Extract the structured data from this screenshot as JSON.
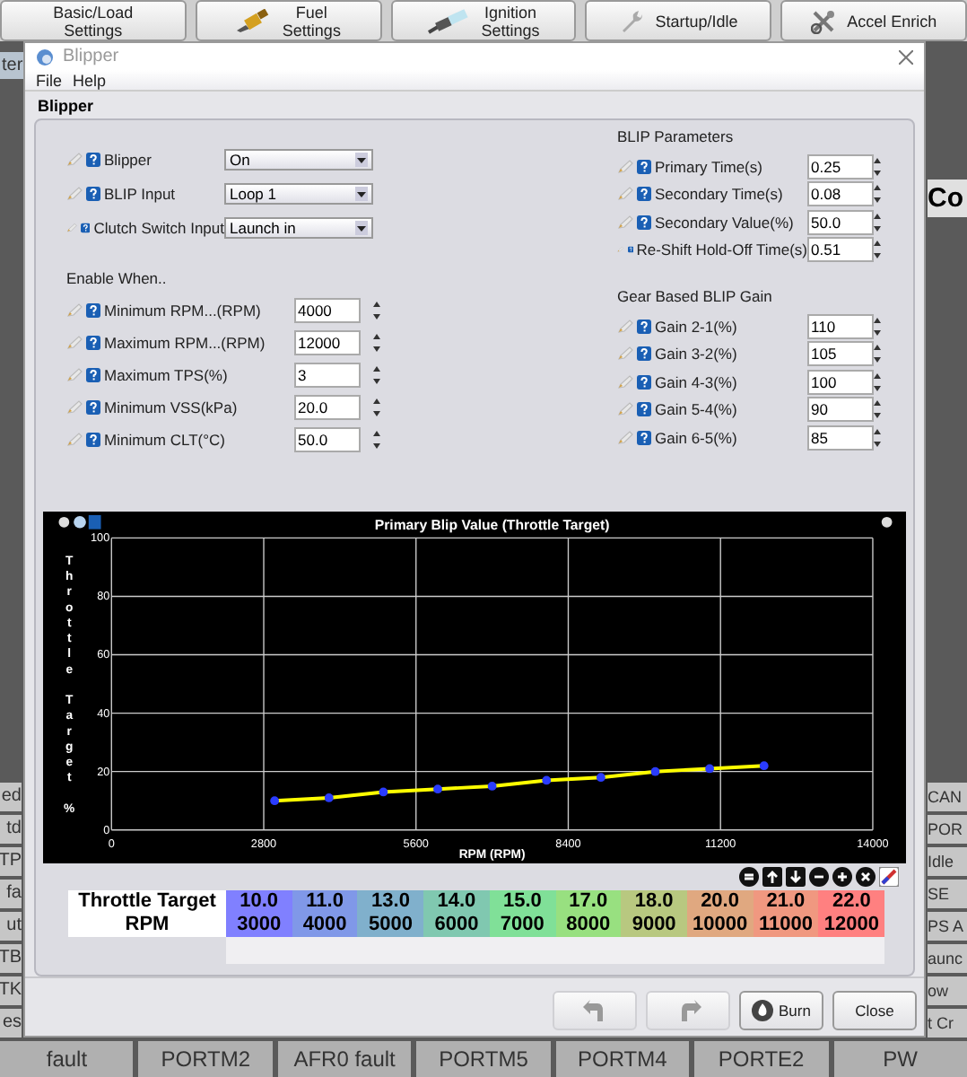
{
  "app": {
    "toolbar": [
      {
        "kind": "plain",
        "lines": [
          "Basic/Load",
          "Settings"
        ]
      },
      {
        "kind": "injector",
        "lines": [
          "Fuel",
          "Settings"
        ]
      },
      {
        "kind": "sparkplug",
        "lines": [
          "Ignition",
          "Settings"
        ]
      },
      {
        "kind": "wrench",
        "lines": [
          "Startup/Idle"
        ]
      },
      {
        "kind": "tools",
        "lines": [
          "Accel Enrich"
        ]
      }
    ],
    "side_tab": "ter",
    "right_heading": "Co",
    "left_strip": [
      "ed",
      "td",
      "TP",
      "fa",
      "ut",
      "TB",
      "TK",
      "es"
    ],
    "right_strip": [
      "CAN",
      "POR",
      "Idle",
      "SE",
      "PS A",
      "aunc",
      "ow",
      "t Cr"
    ],
    "bottom_row": [
      "fault",
      "PORTM2",
      "AFR0 fault",
      "PORTM5",
      "PORTM4",
      "PORTE2",
      "PW"
    ]
  },
  "window": {
    "title": "Blipper",
    "menu": [
      "File",
      "Help"
    ],
    "panel_title": "Blipper",
    "selects": [
      {
        "label": "Blipper",
        "value": "On"
      },
      {
        "label": "BLIP Input",
        "value": "Loop 1"
      },
      {
        "label": "Clutch Switch Input",
        "value": "Launch in"
      }
    ],
    "enable_when": {
      "title": "Enable When..",
      "fields": [
        {
          "label": "Minimum RPM...(RPM)",
          "value": "4000"
        },
        {
          "label": "Maximum RPM...(RPM)",
          "value": "12000"
        },
        {
          "label": "Maximum TPS(%)",
          "value": "3"
        },
        {
          "label": "Minimum VSS(kPa)",
          "value": "20.0"
        },
        {
          "label": "Minimum CLT(°C)",
          "value": "50.0"
        }
      ]
    },
    "blip_parameters": {
      "title": "BLIP Parameters",
      "fields": [
        {
          "label": "Primary Time(s)",
          "value": "0.25"
        },
        {
          "label": "Secondary Time(s)",
          "value": "0.08"
        },
        {
          "label": "Secondary Value(%)",
          "value": "50.0"
        },
        {
          "label": "Re-Shift Hold-Off Time(s)",
          "value": "0.51"
        }
      ]
    },
    "gear_gain": {
      "title": "Gear Based BLIP Gain",
      "fields": [
        {
          "label": "Gain 2-1(%)",
          "value": "110"
        },
        {
          "label": "Gain 3-2(%)",
          "value": "105"
        },
        {
          "label": "Gain 4-3(%)",
          "value": "100"
        },
        {
          "label": "Gain 5-4(%)",
          "value": "90"
        },
        {
          "label": "Gain 6-5(%)",
          "value": "85"
        }
      ]
    },
    "chart_data": {
      "type": "line",
      "title": "Primary Blip Value (Throttle Target)",
      "xlabel": "RPM (RPM)",
      "ylabel": "Throttle Target %",
      "x": [
        3000,
        4000,
        5000,
        6000,
        7000,
        8000,
        9000,
        10000,
        11000,
        12000
      ],
      "series": [
        {
          "color": "#ffff00",
          "marker": "circle",
          "values": [
            10,
            11,
            13,
            14,
            15,
            17,
            18,
            20,
            21,
            22
          ]
        }
      ],
      "grid": true,
      "xlim": [
        0,
        14000
      ],
      "ylim": [
        0,
        100
      ],
      "xticks": [
        0,
        2800,
        5600,
        8400,
        11200,
        14000
      ],
      "yticks": [
        0,
        20,
        40,
        60,
        80,
        100
      ]
    },
    "table": {
      "row_headers": [
        "Throttle Target",
        "RPM"
      ],
      "columns": [
        {
          "value": "10.0",
          "rpm": "3000",
          "color": "#8080ff"
        },
        {
          "value": "11.0",
          "rpm": "4000",
          "color": "#8098e8"
        },
        {
          "value": "13.0",
          "rpm": "5000",
          "color": "#80b0cc"
        },
        {
          "value": "14.0",
          "rpm": "6000",
          "color": "#80c8b0"
        },
        {
          "value": "15.0",
          "rpm": "7000",
          "color": "#80e098"
        },
        {
          "value": "17.0",
          "rpm": "8000",
          "color": "#98e080"
        },
        {
          "value": "18.0",
          "rpm": "9000",
          "color": "#b8c880"
        },
        {
          "value": "20.0",
          "rpm": "10000",
          "color": "#e0a880"
        },
        {
          "value": "21.0",
          "rpm": "11000",
          "color": "#f09880"
        },
        {
          "value": "22.0",
          "rpm": "12000",
          "color": "#ff8080"
        }
      ]
    },
    "buttons": [
      {
        "kind": "undo",
        "disabled": true
      },
      {
        "kind": "redo",
        "disabled": true
      },
      {
        "kind": "burn",
        "label": "Burn",
        "disabled": false
      },
      {
        "kind": "close",
        "label": "Close",
        "disabled": false
      }
    ]
  }
}
